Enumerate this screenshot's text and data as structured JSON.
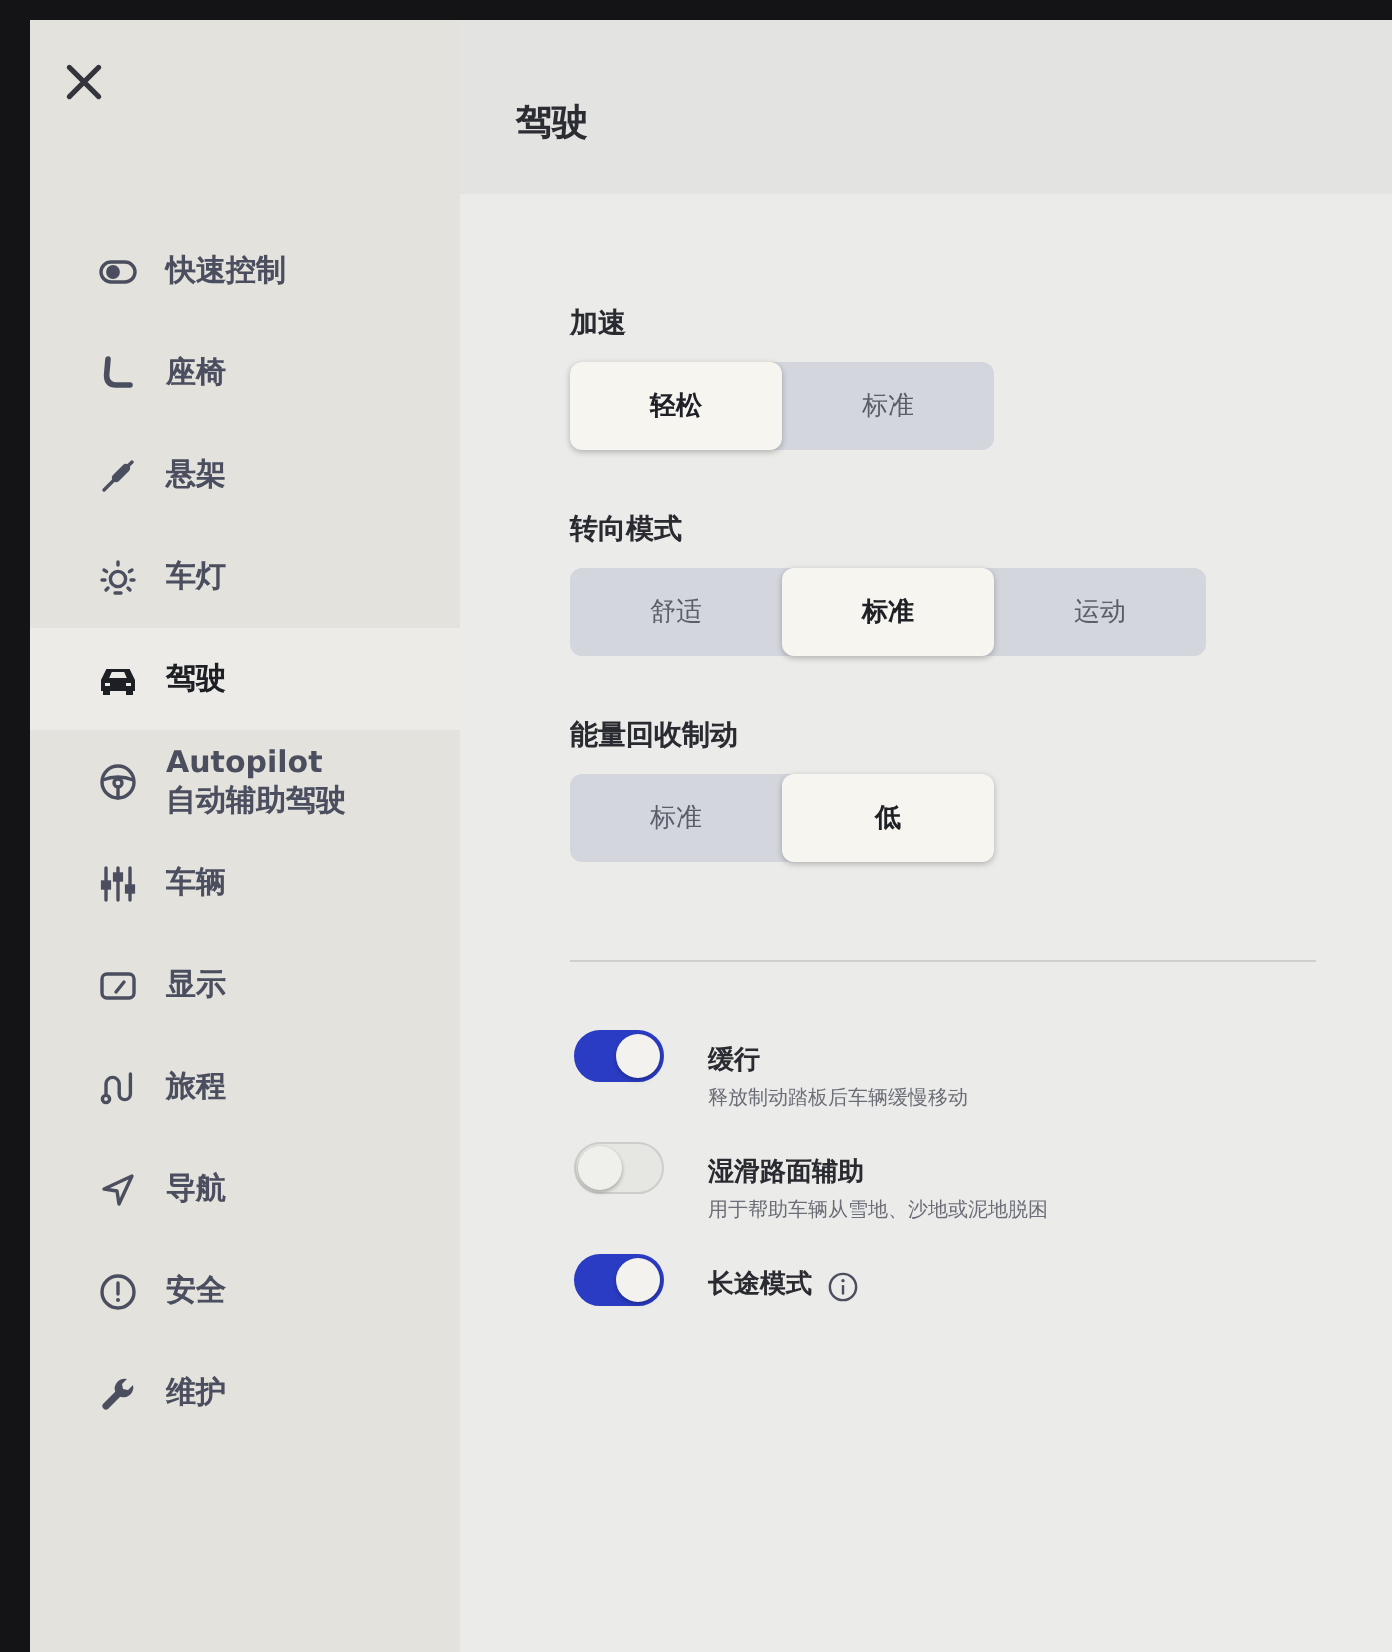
{
  "header": {
    "title": "驾驶"
  },
  "sidebar": {
    "items": [
      {
        "kind": "toggle",
        "label": "快速控制",
        "selected": false
      },
      {
        "kind": "seat",
        "label": "座椅",
        "selected": false
      },
      {
        "kind": "suspension",
        "label": "悬架",
        "selected": false
      },
      {
        "kind": "light",
        "label": "车灯",
        "selected": false
      },
      {
        "kind": "car",
        "label": "驾驶",
        "selected": true
      },
      {
        "kind": "wheel",
        "label": "Autopilot",
        "sublabel": "自动辅助驾驶",
        "selected": false
      },
      {
        "kind": "sliders",
        "label": "车辆",
        "selected": false
      },
      {
        "kind": "display",
        "label": "显示",
        "selected": false
      },
      {
        "kind": "trip",
        "label": "旅程",
        "selected": false
      },
      {
        "kind": "navigation",
        "label": "导航",
        "selected": false
      },
      {
        "kind": "safety",
        "label": "安全",
        "selected": false
      },
      {
        "kind": "service",
        "label": "维护",
        "selected": false
      }
    ]
  },
  "sections": [
    {
      "title": "加速",
      "options": [
        {
          "label": "轻松",
          "selected": true
        },
        {
          "label": "标准",
          "selected": false
        }
      ]
    },
    {
      "title": "转向模式",
      "options": [
        {
          "label": "舒适",
          "selected": false
        },
        {
          "label": "标准",
          "selected": true
        },
        {
          "label": "运动",
          "selected": false
        }
      ]
    },
    {
      "title": "能量回收制动",
      "options": [
        {
          "label": "标准",
          "selected": false
        },
        {
          "label": "低",
          "selected": true
        }
      ]
    }
  ],
  "toggles": [
    {
      "label": "缓行",
      "description": "释放制动踏板后车辆缓慢移动",
      "on": true
    },
    {
      "label": "湿滑路面辅助",
      "description": "用于帮助车辆从雪地、沙地或泥地脱困",
      "on": false
    },
    {
      "label": "长途模式",
      "on": true,
      "info": true
    }
  ]
}
